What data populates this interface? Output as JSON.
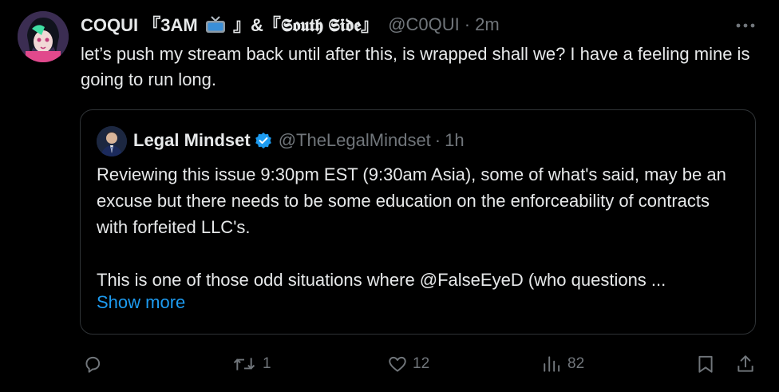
{
  "tweet": {
    "display_name_main": "COQUI 『3AM",
    "display_name_tail": "』&『𝕾𝖔𝖚𝖙𝖍 𝕾𝖎𝖉𝖊』",
    "tv_icon": "tv-emoji",
    "handle": "@C0QUI",
    "separator": "·",
    "time": "2m",
    "text": "let’s push my stream back until after this, is wrapped shall we? I have a feeling mine is going to run long."
  },
  "quote": {
    "name": "Legal Mindset",
    "verified_icon": "verified-badge-icon",
    "handle": "@TheLegalMindset",
    "separator": "·",
    "time": "1h",
    "paragraph1": "Reviewing this issue 9:30pm EST (9:30am Asia), some of what's said, may be an excuse but there needs to be some education on the enforceability of contracts with forfeited LLC's.",
    "paragraph2": "This is one of those odd situations where @FalseEyeD (who questions ...",
    "show_more": "Show more"
  },
  "actions": {
    "reply": {
      "icon": "reply-icon"
    },
    "repost": {
      "icon": "repost-icon",
      "count": "1"
    },
    "like": {
      "icon": "heart-icon",
      "count": "12"
    },
    "views": {
      "icon": "views-icon",
      "count": "82"
    },
    "bookmark": {
      "icon": "bookmark-icon"
    },
    "share": {
      "icon": "share-icon"
    }
  },
  "colors": {
    "background": "#000000",
    "text": "#e7e9ea",
    "muted": "#71767b",
    "link": "#1d9bf0",
    "border": "#2f3336"
  }
}
